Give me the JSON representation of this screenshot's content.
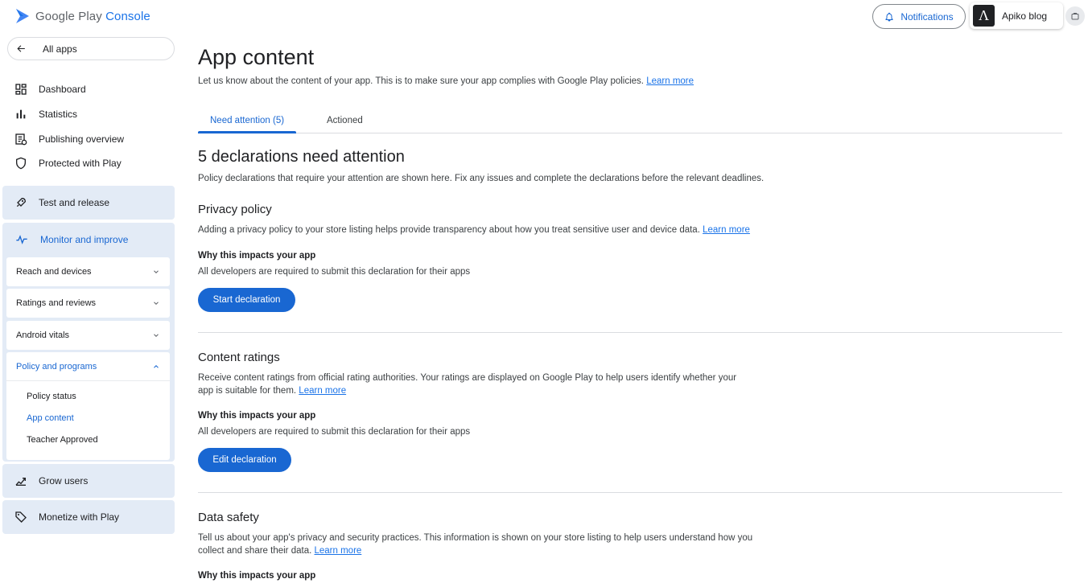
{
  "header": {
    "logo_text_1": "Google Play",
    "logo_text_2": "Console",
    "notifications_label": "Notifications",
    "account_name": "Apiko blog",
    "account_initial": "Λ"
  },
  "sidebar": {
    "all_apps": "All apps",
    "top_items": [
      {
        "label": "Dashboard",
        "icon": "dashboard-icon"
      },
      {
        "label": "Statistics",
        "icon": "bar-chart-icon"
      },
      {
        "label": "Publishing overview",
        "icon": "publishing-icon"
      },
      {
        "label": "Protected with Play",
        "icon": "shield-icon"
      }
    ],
    "test_release": "Test and release",
    "monitor": "Monitor and improve",
    "monitor_sub": [
      {
        "label": "Reach and devices"
      },
      {
        "label": "Ratings and reviews"
      },
      {
        "label": "Android vitals"
      },
      {
        "label": "Policy and programs"
      }
    ],
    "policy_items": [
      "Policy status",
      "App content",
      "Teacher Approved"
    ],
    "grow": "Grow users",
    "monetize": "Monetize with Play"
  },
  "main": {
    "title": "App content",
    "subtitle": "Let us know about the content of your app. This is to make sure your app complies with Google Play policies.",
    "learn_more": "Learn more",
    "tabs": [
      {
        "label": "Need attention (5)"
      },
      {
        "label": "Actioned"
      }
    ],
    "section_title": "5 declarations need attention",
    "section_desc": "Policy declarations that require your attention are shown here. Fix any issues and complete the declarations before the relevant deadlines.",
    "declarations": [
      {
        "title": "Privacy policy",
        "desc": "Adding a privacy policy to your store listing helps provide transparency about how you treat sensitive user and device data.",
        "why": "Why this impacts your app",
        "req": "All developers are required to submit this declaration for their apps",
        "button": "Start declaration"
      },
      {
        "title": "Content ratings",
        "desc": "Receive content ratings from official rating authorities. Your ratings are displayed on Google Play to help users identify whether your app is suitable for them.",
        "why": "Why this impacts your app",
        "req": "All developers are required to submit this declaration for their apps",
        "button": "Edit declaration"
      },
      {
        "title": "Data safety",
        "desc": "Tell us about your app's privacy and security practices. This information is shown on your store listing to help users understand how you collect and share their data.",
        "why": "Why this impacts your app"
      }
    ]
  },
  "colors": {
    "accent": "#1967d2",
    "nav_group_bg": "#e3ebf6"
  }
}
